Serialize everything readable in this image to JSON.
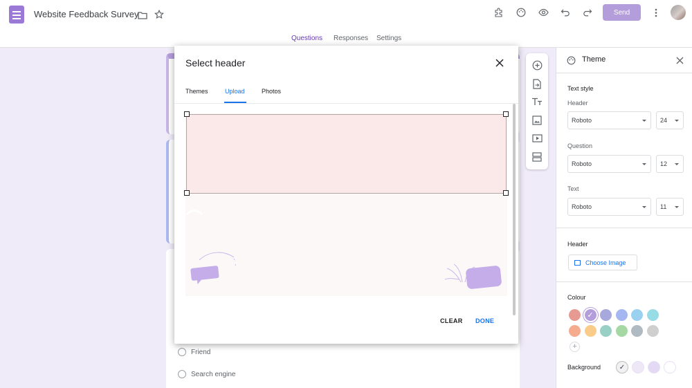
{
  "app": {
    "title": "Website Feedback Survey",
    "send_label": "Send"
  },
  "tabs": [
    {
      "label": "Questions"
    },
    {
      "label": "Responses"
    },
    {
      "label": "Settings"
    }
  ],
  "form": {
    "options": [
      {
        "label": "Friend"
      },
      {
        "label": "Search engine"
      }
    ]
  },
  "dialog": {
    "title": "Select header",
    "tabs": [
      {
        "label": "Themes"
      },
      {
        "label": "Upload"
      },
      {
        "label": "Photos"
      }
    ],
    "active_tab": "Upload",
    "clear_label": "CLEAR",
    "done_label": "DONE"
  },
  "theme_panel": {
    "title": "Theme",
    "text_style_label": "Text style",
    "header_label": "Header",
    "header_font": "Roboto",
    "header_size": "24",
    "question_label": "Question",
    "question_font": "Roboto",
    "question_size": "12",
    "text_label": "Text",
    "text_font": "Roboto",
    "text_size": "11",
    "header_section_label": "Header",
    "choose_image_label": "Choose Image",
    "colour_label": "Colour",
    "colours": [
      "#e69a92",
      "#b39ddb",
      "#a7a9dc",
      "#a5b7f0",
      "#9ad0f0",
      "#98dce6",
      "#f5ab8e",
      "#f9cc8a",
      "#98d0c6",
      "#a6d8a4",
      "#b0bac2",
      "#cfcfcf"
    ],
    "selected_colour_index": 1,
    "background_label": "Background",
    "backgrounds": [
      "#f1f1f3",
      "#ede7f6",
      "#e3d9f4",
      "#ffffff"
    ],
    "selected_background_index": 0
  }
}
